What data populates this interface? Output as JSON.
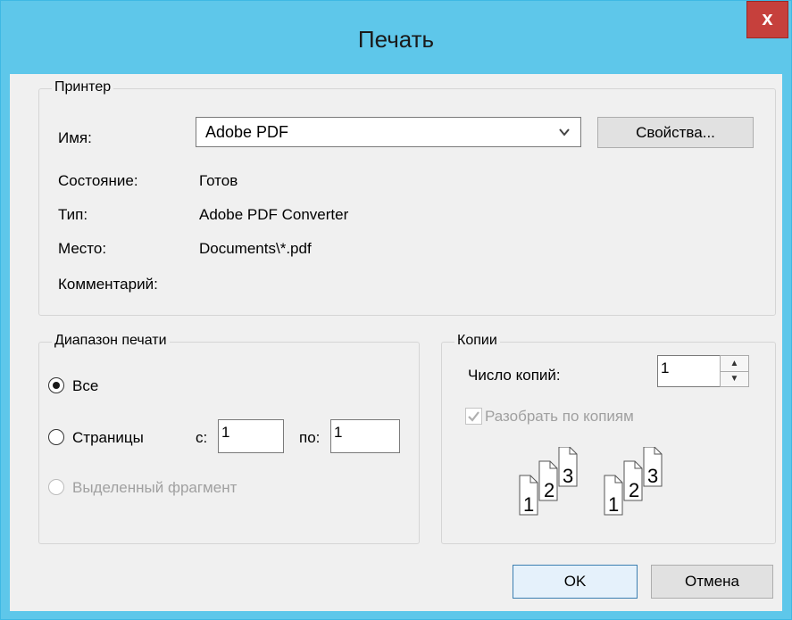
{
  "window": {
    "title": "Печать",
    "close_label": "x"
  },
  "printer": {
    "legend": "Принтер",
    "name_label": "Имя:",
    "name_value": "Adobe PDF",
    "properties_label": "Свойства...",
    "status_label": "Состояние:",
    "status_value": "Готов",
    "type_label": "Тип:",
    "type_value": "Adobe PDF Converter",
    "location_label": "Место:",
    "location_value": "Documents\\*.pdf",
    "comment_label": "Комментарий:"
  },
  "range": {
    "legend": "Диапазон печати",
    "all_label": "Все",
    "pages_label": "Страницы",
    "from_label": "с:",
    "from_value": "1",
    "to_label": "по:",
    "to_value": "1",
    "selection_label": "Выделенный фрагмент"
  },
  "copies": {
    "legend": "Копии",
    "count_label": "Число копий:",
    "count_value": "1",
    "collate_label": "Разобрать по копиям",
    "collate_checked": true,
    "sheet_numbers": [
      "1",
      "2",
      "3"
    ]
  },
  "buttons": {
    "ok_label": "OK",
    "cancel_label": "Отмена"
  },
  "colors": {
    "titlebar": "#5ec7ea",
    "close": "#c6403c",
    "dialog_bg": "#f0f0f0"
  }
}
